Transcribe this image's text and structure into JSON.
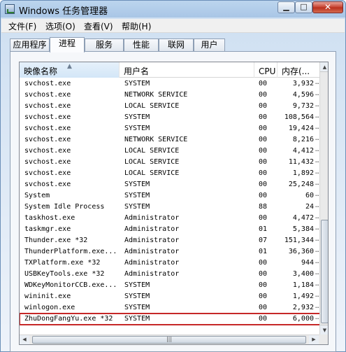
{
  "window": {
    "title": "Windows 任务管理器",
    "min_label": "▁",
    "max_label": "□",
    "close_label": "✕"
  },
  "menu": [
    "文件(F)",
    "选项(O)",
    "查看(V)",
    "帮助(H)"
  ],
  "tabs": [
    "应用程序",
    "进程",
    "服务",
    "性能",
    "联网",
    "用户"
  ],
  "active_tab": "进程",
  "columns": {
    "name": "映像名称",
    "user": "用户名",
    "cpu": "CPU",
    "mem": "内存(..."
  },
  "sort_indicator": "▲",
  "rows": [
    {
      "name": "svchost.exe",
      "user": "SYSTEM",
      "cpu": "00",
      "mem": "3,932"
    },
    {
      "name": "svchost.exe",
      "user": "NETWORK SERVICE",
      "cpu": "00",
      "mem": "4,596"
    },
    {
      "name": "svchost.exe",
      "user": "LOCAL SERVICE",
      "cpu": "00",
      "mem": "9,732"
    },
    {
      "name": "svchost.exe",
      "user": "SYSTEM",
      "cpu": "00",
      "mem": "108,564"
    },
    {
      "name": "svchost.exe",
      "user": "SYSTEM",
      "cpu": "00",
      "mem": "19,424"
    },
    {
      "name": "svchost.exe",
      "user": "NETWORK SERVICE",
      "cpu": "00",
      "mem": "8,216"
    },
    {
      "name": "svchost.exe",
      "user": "LOCAL SERVICE",
      "cpu": "00",
      "mem": "4,412"
    },
    {
      "name": "svchost.exe",
      "user": "LOCAL SERVICE",
      "cpu": "00",
      "mem": "11,432"
    },
    {
      "name": "svchost.exe",
      "user": "LOCAL SERVICE",
      "cpu": "00",
      "mem": "1,892"
    },
    {
      "name": "svchost.exe",
      "user": "SYSTEM",
      "cpu": "00",
      "mem": "25,248"
    },
    {
      "name": "System",
      "user": "SYSTEM",
      "cpu": "00",
      "mem": "60"
    },
    {
      "name": "System Idle Process",
      "user": "SYSTEM",
      "cpu": "88",
      "mem": "24"
    },
    {
      "name": "taskhost.exe",
      "user": "Administrator",
      "cpu": "00",
      "mem": "4,472"
    },
    {
      "name": "taskmgr.exe",
      "user": "Administrator",
      "cpu": "01",
      "mem": "5,384"
    },
    {
      "name": "Thunder.exe *32",
      "user": "Administrator",
      "cpu": "07",
      "mem": "151,344"
    },
    {
      "name": "ThunderPlatform.exe...",
      "user": "Administrator",
      "cpu": "01",
      "mem": "36,360"
    },
    {
      "name": "TXPlatform.exe *32",
      "user": "Administrator",
      "cpu": "00",
      "mem": "944"
    },
    {
      "name": "USBKeyTools.exe *32",
      "user": "Administrator",
      "cpu": "00",
      "mem": "3,400"
    },
    {
      "name": "WDKeyMonitorCCB.exe...",
      "user": "SYSTEM",
      "cpu": "00",
      "mem": "1,184"
    },
    {
      "name": "wininit.exe",
      "user": "SYSTEM",
      "cpu": "00",
      "mem": "1,492"
    },
    {
      "name": "winlogon.exe",
      "user": "SYSTEM",
      "cpu": "00",
      "mem": "2,932"
    },
    {
      "name": "ZhuDongFangYu.exe *32",
      "user": "SYSTEM",
      "cpu": "00",
      "mem": "6,000"
    }
  ],
  "highlighted_row": 21,
  "highlight_color": "#c62828",
  "row_truncation": "…",
  "hscroll_grip": "|||"
}
